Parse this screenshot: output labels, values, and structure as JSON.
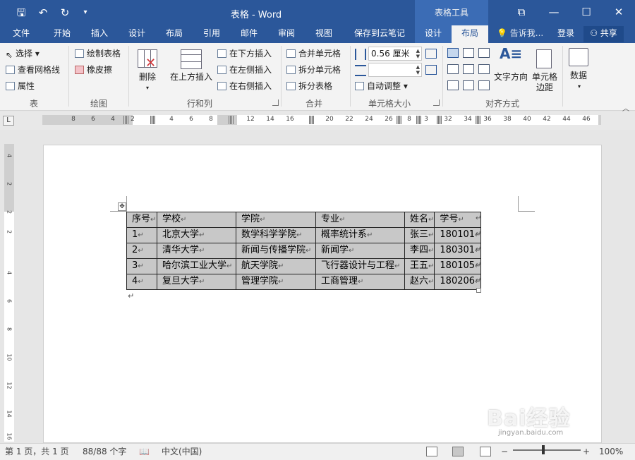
{
  "titlebar": {
    "title": "表格 - Word",
    "context_header": "表格工具",
    "save_icon": "save-icon",
    "undo_icon": "undo-icon",
    "redo_icon": "redo-icon",
    "customize_icon": "customize-icon"
  },
  "tabs": [
    {
      "label": "文件"
    },
    {
      "label": "开始"
    },
    {
      "label": "插入"
    },
    {
      "label": "设计"
    },
    {
      "label": "布局"
    },
    {
      "label": "引用"
    },
    {
      "label": "邮件"
    },
    {
      "label": "审阅"
    },
    {
      "label": "视图"
    },
    {
      "label": "保存到云笔记"
    },
    {
      "label": "设计"
    },
    {
      "label": "布局"
    }
  ],
  "tellme": "告诉我...",
  "login": "登录",
  "share": "共享",
  "ribbon": {
    "table_group": {
      "label": "表",
      "select": "选择",
      "gridlines": "查看网格线",
      "properties": "属性"
    },
    "draw_group": {
      "label": "绘图",
      "draw_table": "绘制表格",
      "eraser": "橡皮擦"
    },
    "rowscols_group": {
      "label": "行和列",
      "delete": "删除",
      "insert_above": "在上方插入",
      "insert_below": "在下方插入",
      "insert_left": "在左侧插入",
      "insert_right": "在右侧插入"
    },
    "merge_group": {
      "label": "合并",
      "merge_cells": "合并单元格",
      "split_cells": "拆分单元格",
      "split_table": "拆分表格"
    },
    "cellsize_group": {
      "label": "单元格大小",
      "height_value": "0.56 厘米",
      "width_value": "",
      "autofit": "自动调整"
    },
    "align_group": {
      "label": "对齐方式",
      "text_direction": "文字方向",
      "cell_margins": "单元格边距"
    },
    "data_group": {
      "data": "数据"
    }
  },
  "ruler": {
    "h_numbers_left": [
      "8",
      "6",
      "4",
      "2"
    ],
    "h_numbers_right": [
      "4",
      "6",
      "8",
      "12",
      "14",
      "16",
      "20",
      "22",
      "24",
      "26",
      "8",
      "3",
      "32",
      "34",
      "36",
      "38",
      "40",
      "42",
      "44",
      "46"
    ],
    "v_numbers": [
      "4",
      "2",
      "2",
      "2",
      "4",
      "6",
      "8",
      "10",
      "12",
      "14",
      "16"
    ],
    "corner": "L"
  },
  "document": {
    "table": [
      [
        "序号",
        "学校",
        "学院",
        "专业",
        "姓名",
        "学号"
      ],
      [
        "1",
        "北京大学",
        "数学科学学院",
        "概率统计系",
        "张三",
        "180101"
      ],
      [
        "2",
        "清华大学",
        "新闻与传播学院",
        "新闻学",
        "李四",
        "180301"
      ],
      [
        "3",
        "哈尔滨工业大学",
        "航天学院",
        "飞行器设计与工程",
        "王五",
        "180105"
      ],
      [
        "4",
        "复旦大学",
        "管理学院",
        "工商管理",
        "赵六",
        "180206"
      ]
    ],
    "cell_mark": "↵",
    "para_mark": "↵"
  },
  "statusbar": {
    "page": "第 1 页，共 1 页",
    "words": "88/88 个字",
    "language": "中文(中国)",
    "zoom": "100%",
    "zoom_out": "−",
    "zoom_in": "+"
  },
  "watermark": {
    "logo": "Bai经验",
    "url": "jingyan.baidu.com"
  },
  "colors": {
    "brand": "#2b579a",
    "context": "#3b6cb5",
    "table_fill": "#c8c8c8"
  }
}
